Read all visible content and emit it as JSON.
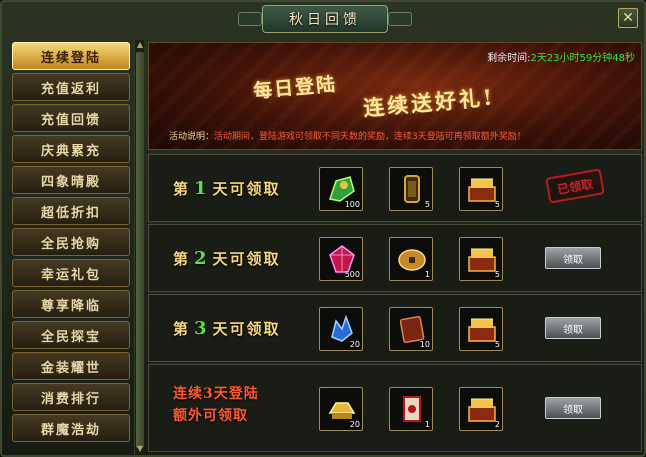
{
  "window": {
    "title": "秋日回馈",
    "close_label": "✕"
  },
  "sidebar": {
    "items": [
      {
        "label": "连续登陆",
        "active": true
      },
      {
        "label": "充值返利"
      },
      {
        "label": "充值回馈"
      },
      {
        "label": "庆典累充"
      },
      {
        "label": "四象晴殿"
      },
      {
        "label": "超低折扣"
      },
      {
        "label": "全民抢购"
      },
      {
        "label": "幸运礼包"
      },
      {
        "label": "尊享降临"
      },
      {
        "label": "全民探宝"
      },
      {
        "label": "金装耀世"
      },
      {
        "label": "消费排行"
      },
      {
        "label": "群魔浩劫"
      }
    ]
  },
  "banner": {
    "timer_label": "剩余时间:",
    "timer_value": "2天23小时59分钟48秒",
    "headline_1": "每日登陆",
    "headline_2": "连续送好礼!",
    "desc_label": "活动说明：",
    "desc_text": "活动期间，登陆游戏可领取不同天数的奖励，连续3天登陆可再领取额外奖励！"
  },
  "rewards": [
    {
      "label_prefix": "第",
      "day": "1",
      "label_suffix": "天可领取",
      "status": "claimed",
      "status_label": "已领取",
      "items": [
        {
          "icon": "green-jade-icon",
          "count": "100"
        },
        {
          "icon": "scroll-token-icon",
          "count": "5"
        },
        {
          "icon": "gold-chest-icon",
          "count": "5"
        }
      ]
    },
    {
      "label_prefix": "第",
      "day": "2",
      "label_suffix": "天可领取",
      "status": "claimable",
      "status_label": "领取",
      "items": [
        {
          "icon": "red-gem-icon",
          "count": "500"
        },
        {
          "icon": "bronze-coin-icon",
          "count": "1"
        },
        {
          "icon": "gold-chest-icon",
          "count": "5"
        }
      ]
    },
    {
      "label_prefix": "第",
      "day": "3",
      "label_suffix": "天可领取",
      "status": "claimable",
      "status_label": "领取",
      "items": [
        {
          "icon": "blue-crystal-icon",
          "count": "20"
        },
        {
          "icon": "red-book-icon",
          "count": "10"
        },
        {
          "icon": "gold-chest-icon",
          "count": "5"
        }
      ]
    },
    {
      "special_line1": "连续3天登陆",
      "special_line2": "额外可领取",
      "status": "claimable",
      "status_label": "领取",
      "items": [
        {
          "icon": "gold-ingot-icon",
          "count": "20"
        },
        {
          "icon": "red-scroll-icon",
          "count": "1"
        },
        {
          "icon": "gold-chest-icon",
          "count": "2"
        }
      ]
    }
  ]
}
